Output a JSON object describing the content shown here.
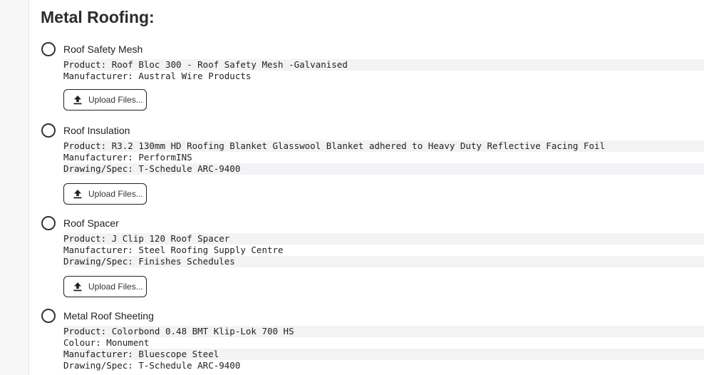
{
  "section": {
    "title": "Metal Roofing:"
  },
  "upload_label": "Upload Files...",
  "items": [
    {
      "label": "Roof Safety Mesh",
      "lines": [
        "Product: Roof Bloc 300 - Roof Safety Mesh -Galvanised",
        "Manufacturer: Austral Wire Products"
      ]
    },
    {
      "label": "Roof Insulation",
      "lines": [
        "Product: R3.2 130mm HD Roofing Blanket Glasswool Blanket adhered to Heavy Duty Reflective Facing Foil",
        "Manufacturer: PerformINS",
        "Drawing/Spec: T-Schedule ARC-9400"
      ]
    },
    {
      "label": "Roof Spacer",
      "lines": [
        "Product: J Clip 120 Roof Spacer",
        "Manufacturer: Steel Roofing Supply Centre",
        "Drawing/Spec: Finishes Schedules"
      ]
    },
    {
      "label": "Metal Roof Sheeting",
      "lines": [
        "Product: Colorbond 0.48 BMT Klip-Lok 700 HS",
        "Colour: Monument",
        "Manufacturer: Bluescope Steel",
        "Drawing/Spec: T-Schedule ARC-9400"
      ]
    }
  ]
}
